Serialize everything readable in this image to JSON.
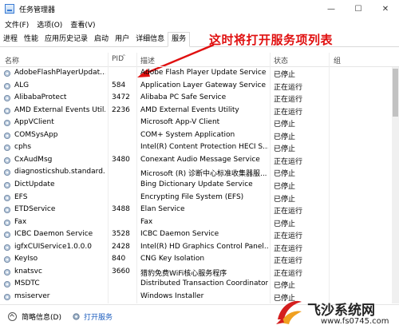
{
  "window": {
    "title": "任务管理器",
    "minimize": "—",
    "maximize": "☐",
    "close": "✕"
  },
  "menu": [
    "文件(F)",
    "选项(O)",
    "查看(V)"
  ],
  "tabs": [
    {
      "label": "进程",
      "active": false
    },
    {
      "label": "性能",
      "active": false
    },
    {
      "label": "应用历史记录",
      "active": false
    },
    {
      "label": "启动",
      "active": false
    },
    {
      "label": "用户",
      "active": false
    },
    {
      "label": "详细信息",
      "active": false
    },
    {
      "label": "服务",
      "active": true
    }
  ],
  "annotation": {
    "text": "这时将打开服务项列表",
    "color": "#e01010"
  },
  "columns": {
    "name": "名称",
    "pid": "PID",
    "description": "描述",
    "status": "状态",
    "group": "组"
  },
  "services": [
    {
      "name": "AdobeFlashPlayerUpdat...",
      "pid": "",
      "description": "Adobe Flash Player Update Service",
      "status": "已停止"
    },
    {
      "name": "ALG",
      "pid": "584",
      "description": "Application Layer Gateway Service",
      "status": "正在运行"
    },
    {
      "name": "AlibabaProtect",
      "pid": "3472",
      "description": "Alibaba PC Safe Service",
      "status": "正在运行"
    },
    {
      "name": "AMD External Events Util...",
      "pid": "2236",
      "description": "AMD External Events Utility",
      "status": "正在运行"
    },
    {
      "name": "AppVClient",
      "pid": "",
      "description": "Microsoft App-V Client",
      "status": "已停止"
    },
    {
      "name": "COMSysApp",
      "pid": "",
      "description": "COM+ System Application",
      "status": "已停止"
    },
    {
      "name": "cphs",
      "pid": "",
      "description": "Intel(R) Content Protection HECI S...",
      "status": "已停止"
    },
    {
      "name": "CxAudMsg",
      "pid": "3480",
      "description": "Conexant Audio Message Service",
      "status": "正在运行"
    },
    {
      "name": "diagnosticshub.standard...",
      "pid": "",
      "description": "Microsoft (R) 诊断中心标准收集器服...",
      "status": "已停止"
    },
    {
      "name": "DictUpdate",
      "pid": "",
      "description": "Bing Dictionary Update Service",
      "status": "已停止"
    },
    {
      "name": "EFS",
      "pid": "",
      "description": "Encrypting File System (EFS)",
      "status": "已停止"
    },
    {
      "name": "ETDService",
      "pid": "3488",
      "description": "Elan Service",
      "status": "正在运行"
    },
    {
      "name": "Fax",
      "pid": "",
      "description": "Fax",
      "status": "已停止"
    },
    {
      "name": "ICBC Daemon Service",
      "pid": "3528",
      "description": "ICBC Daemon Service",
      "status": "正在运行"
    },
    {
      "name": "igfxCUIService1.0.0.0",
      "pid": "2428",
      "description": "Intel(R) HD Graphics Control Panel...",
      "status": "正在运行"
    },
    {
      "name": "KeyIso",
      "pid": "840",
      "description": "CNG Key Isolation",
      "status": "正在运行"
    },
    {
      "name": "knatsvc",
      "pid": "3660",
      "description": "猎豹免费WiFi核心服务程序",
      "status": "正在运行"
    },
    {
      "name": "MSDTC",
      "pid": "",
      "description": "Distributed Transaction Coordinator",
      "status": "已停止"
    },
    {
      "name": "msiserver",
      "pid": "",
      "description": "Windows Installer",
      "status": "已停止"
    }
  ],
  "footer": {
    "fewer_details": "简略信息(D)",
    "open_services": "打开服务"
  },
  "watermark": {
    "brand": "飞沙系统网",
    "url": "www.fs0745.com"
  }
}
